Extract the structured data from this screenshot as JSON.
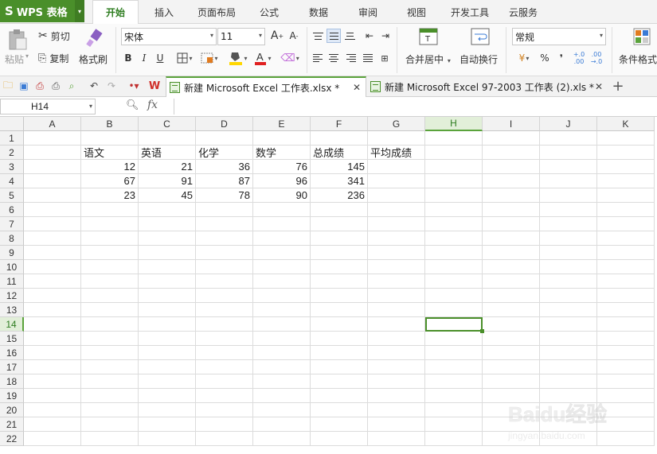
{
  "app": {
    "name": "WPS 表格",
    "logo": "S"
  },
  "menu": {
    "tabs": [
      {
        "label": "开始",
        "active": true
      },
      {
        "label": "插入"
      },
      {
        "label": "页面布局"
      },
      {
        "label": "公式"
      },
      {
        "label": "数据"
      },
      {
        "label": "审阅"
      },
      {
        "label": "视图"
      },
      {
        "label": "开发工具"
      },
      {
        "label": "云服务"
      }
    ]
  },
  "ribbon": {
    "paste": "粘贴",
    "cut": "剪切",
    "copy": "复制",
    "format_painter": "格式刷",
    "font_name": "宋体",
    "font_size": "11",
    "merge_center": "合并居中",
    "wrap_text": "自动换行",
    "number_format": "常规",
    "percent": "%",
    "thousands": "❜",
    "conditional_format": "条件格式",
    "colors": {
      "highlight": "#ffd700",
      "font": "#e02020"
    }
  },
  "doc_tabs": [
    {
      "label": "新建 Microsoft Excel 工作表.xlsx *",
      "active": true
    },
    {
      "label": "新建 Microsoft Excel 97-2003 工作表 (2).xls *"
    }
  ],
  "formula_bar": {
    "cell_ref": "H14",
    "fx": "fx",
    "content": ""
  },
  "sheet": {
    "columns": [
      "A",
      "B",
      "C",
      "D",
      "E",
      "F",
      "G",
      "H",
      "I",
      "J",
      "K"
    ],
    "rows": [
      "1",
      "2",
      "3",
      "4",
      "5",
      "6",
      "7",
      "8",
      "9",
      "10",
      "11",
      "12",
      "13",
      "14",
      "15",
      "16",
      "17",
      "18",
      "19",
      "20",
      "21",
      "22"
    ],
    "selected_col": "H",
    "selected_row": "14",
    "headers_row2": [
      "语文",
      "英语",
      "化学",
      "数学",
      "总成绩",
      "平均成绩"
    ],
    "data": [
      [
        "12",
        "21",
        "36",
        "76",
        "145"
      ],
      [
        "67",
        "91",
        "87",
        "96",
        "341"
      ],
      [
        "23",
        "45",
        "78",
        "90",
        "236"
      ]
    ]
  },
  "watermark": {
    "text": "Baidu经验",
    "sub": "jingyan.baidu.com"
  },
  "accent_color": "#4a8f2a"
}
